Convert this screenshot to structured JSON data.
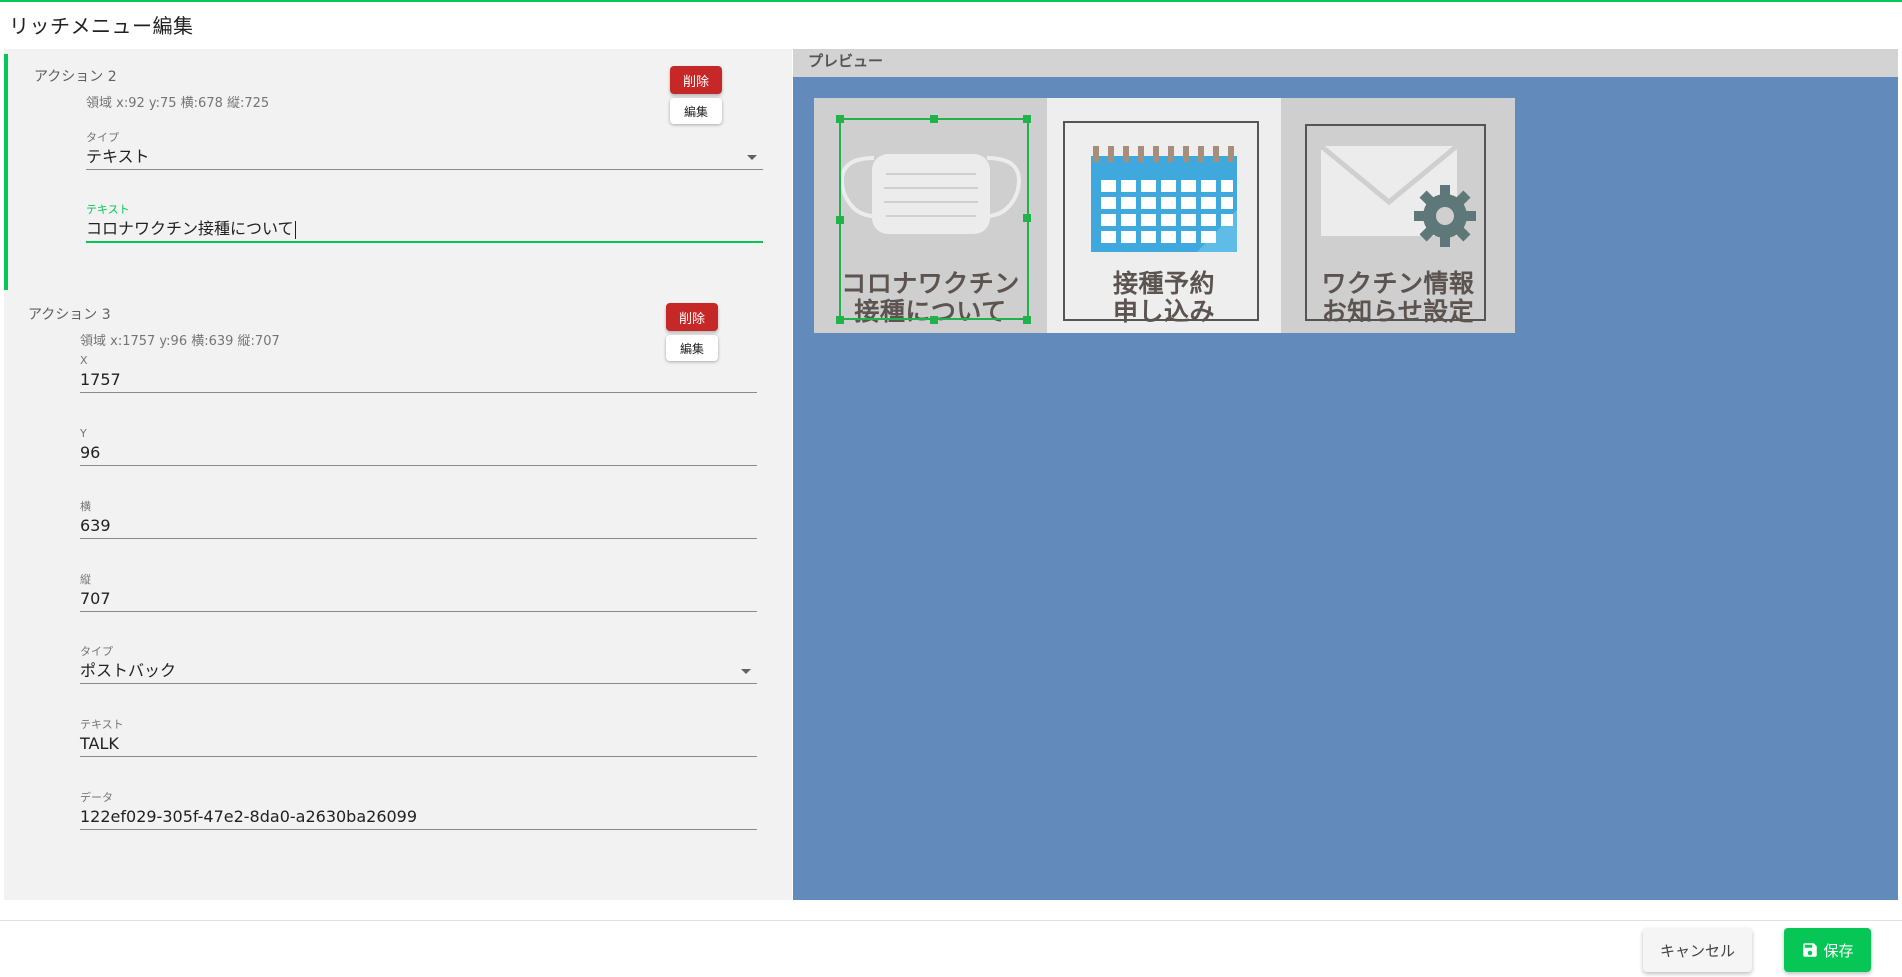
{
  "page": {
    "title": "リッチメニュー編集"
  },
  "actions": [
    {
      "title": "アクション 2",
      "area": "領域 x:92 y:75 横:678 縦:725",
      "delete_label": "削除",
      "edit_label": "編集",
      "fields": {
        "type": {
          "label": "タイプ",
          "value": "テキスト"
        },
        "text": {
          "label": "テキスト",
          "value": "コロナワクチン接種について"
        }
      }
    },
    {
      "title": "アクション 3",
      "area": "領域 x:1757 y:96 横:639 縦:707",
      "delete_label": "削除",
      "edit_label": "編集",
      "fields": {
        "x": {
          "label": "X",
          "value": "1757"
        },
        "y": {
          "label": "Y",
          "value": "96"
        },
        "w": {
          "label": "横",
          "value": "639"
        },
        "h": {
          "label": "縦",
          "value": "707"
        },
        "type": {
          "label": "タイプ",
          "value": "ポストバック"
        },
        "text": {
          "label": "テキスト",
          "value": "TALK"
        },
        "data": {
          "label": "データ",
          "value": "122ef029-305f-47e2-8da0-a2630ba26099"
        }
      }
    }
  ],
  "preview": {
    "header": "プレビュー",
    "tiles": [
      {
        "line1": "コロナワクチン",
        "line2": "接種について",
        "icon": "mask-icon",
        "selected": true
      },
      {
        "line1": "接種予約",
        "line2": "申し込み",
        "icon": "calendar-icon",
        "selected": false
      },
      {
        "line1": "ワクチン情報",
        "line2": "お知らせ設定",
        "icon": "mail-gear-icon",
        "selected": false
      }
    ]
  },
  "footer": {
    "cancel_label": "キャンセル",
    "save_label": "保存",
    "save_icon": "save-icon"
  },
  "colors": {
    "accent": "#06c755",
    "danger": "#c62828",
    "preview_bg": "#628aba"
  }
}
